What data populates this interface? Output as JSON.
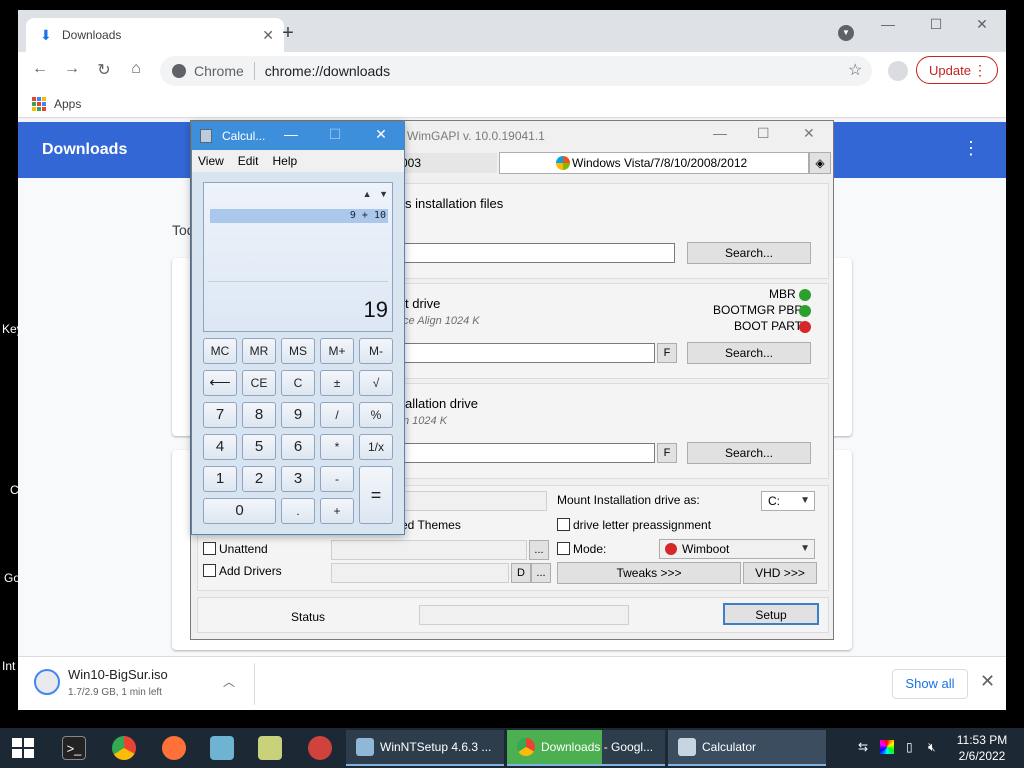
{
  "desktop": {
    "edge_labels": [
      "Key",
      "C",
      "Go",
      "Int"
    ]
  },
  "chrome": {
    "tab_title": "Downloads",
    "new_tab": "+",
    "omnibox_chip": "Chrome",
    "url": "chrome://downloads",
    "update_label": "Update",
    "bookmarks_apps": "Apps",
    "page_title": "Downloads",
    "today_label": "Tod",
    "shelf": {
      "filename": "Win10-BigSur.iso",
      "status": "1.7/2.9 GB, 1 min left",
      "show_all": "Show all"
    },
    "accent": "#3367d6"
  },
  "winntsetup": {
    "title": "WimGAPI v. 10.0.19041.1",
    "left_combo_partial": "003",
    "os_combo": "Windows Vista/7/8/10/2008/2012",
    "section1_partial": "s installation files",
    "section2_partial": "t drive",
    "section2_sub": "ce Align 1024 K",
    "section3_partial": "allation drive",
    "section3_sub": "n 1024 K",
    "search_label": "Search...",
    "f_label": "F",
    "boot_status": [
      {
        "label": "MBR",
        "color": "#2ca02c"
      },
      {
        "label": "BOOTMGR PBR",
        "color": "#2ca02c"
      },
      {
        "label": "BOOT PART",
        "color": "#d62728"
      }
    ],
    "mount_label": "Mount Installation drive as:",
    "mount_value": "C:",
    "themes_partial": "ed Themes",
    "drive_letter_label": "drive letter preassignment",
    "unattend_label": "Unattend",
    "add_drivers_label": "Add Drivers",
    "mode_label": "Mode:",
    "mode_value": "Wimboot",
    "d_label": "D",
    "ellipsis": "...",
    "tweaks_label": "Tweaks >>>",
    "vhd_label": "VHD >>>",
    "status_label": "Status",
    "setup_label": "Setup"
  },
  "calculator": {
    "title": "Calcul...",
    "menu": [
      "View",
      "Edit",
      "Help"
    ],
    "history": "9 + 10",
    "value": "19",
    "buttons": [
      [
        "MC",
        "MR",
        "MS",
        "M+",
        "M-"
      ],
      [
        "⟵",
        "CE",
        "C",
        "±",
        "√"
      ],
      [
        "7",
        "8",
        "9",
        "/",
        "%"
      ],
      [
        "4",
        "5",
        "6",
        "*",
        "1/x"
      ],
      [
        "1",
        "2",
        "3",
        "-",
        "="
      ],
      [
        "0",
        ".",
        "+"
      ]
    ]
  },
  "taskbar": {
    "tasks": [
      {
        "label": "WinNTSetup 4.6.3  ...",
        "color": "#3b4d5e"
      },
      {
        "label": "Downloads - Googl...",
        "color": "#4caf50"
      },
      {
        "label": "Calculator",
        "color": "#3b4d5e"
      }
    ],
    "time": "11:53 PM",
    "date": "2/6/2022"
  }
}
